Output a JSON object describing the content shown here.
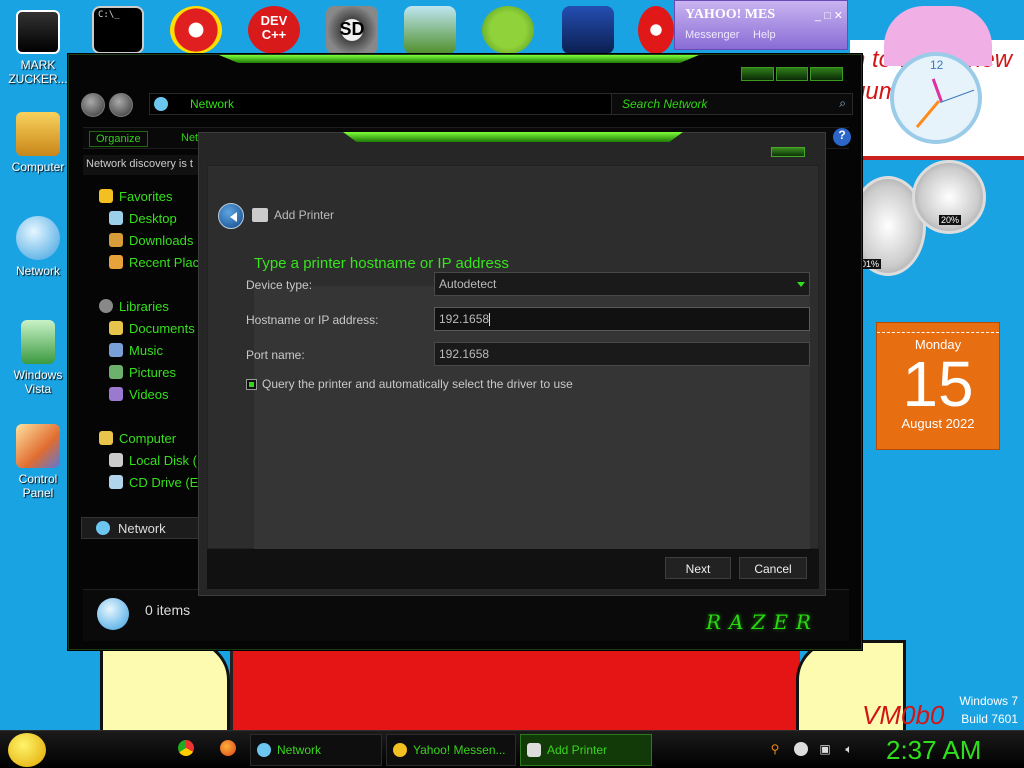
{
  "desktop": {
    "icons": [
      {
        "label": "MARK ZUCKER...",
        "icon": "person-icon"
      },
      {
        "label": "Computer",
        "icon": "computer-icon"
      },
      {
        "label": "Network",
        "icon": "network-icon"
      },
      {
        "label": "Windows Vista",
        "icon": "recycle-bin-icon"
      },
      {
        "label": "Control Panel",
        "icon": "control-panel-icon"
      }
    ],
    "top_icons": [
      "cmd-icon",
      "pinball-icon",
      "devcpp-icon",
      "settings-sd-icon",
      "folder-icon",
      "angry-birds-icon",
      "star-wars-icon",
      "radiation-icon"
    ],
    "devcpp_text": "DEV C++",
    "sd_text": "SD",
    "watermark_line1": "Windows 7",
    "watermark_line2": "Build 7601",
    "build_watermark": "VM0b0"
  },
  "explorer": {
    "address": "Network",
    "search_placeholder": "Search Network",
    "organize": "Organize",
    "toolbar_cut": "Net",
    "discovery_notice": "Network discovery is t",
    "nav": [
      {
        "label": "Favorites",
        "icon": "star-icon"
      },
      {
        "label": "Desktop",
        "icon": "desktop-icon"
      },
      {
        "label": "Downloads",
        "icon": "downloads-icon"
      },
      {
        "label": "Recent Plac",
        "icon": "recent-places-icon"
      },
      {
        "label": "Libraries",
        "icon": "libraries-icon"
      },
      {
        "label": "Documents",
        "icon": "documents-icon"
      },
      {
        "label": "Music",
        "icon": "music-icon"
      },
      {
        "label": "Pictures",
        "icon": "pictures-icon"
      },
      {
        "label": "Videos",
        "icon": "videos-icon"
      },
      {
        "label": "Computer",
        "icon": "computer-icon"
      },
      {
        "label": "Local Disk (",
        "icon": "disk-icon"
      },
      {
        "label": "CD Drive (E",
        "icon": "cd-drive-icon"
      }
    ],
    "nav_selected": "Network",
    "item_count": "0 items",
    "brand": "RAZER"
  },
  "dialog": {
    "title": "Add Printer",
    "heading": "Type a printer hostname or IP address",
    "device_type_label": "Device type:",
    "device_type_value": "Autodetect",
    "hostname_label": "Hostname or IP address:",
    "hostname_value": "192.1658",
    "port_label": "Port name:",
    "port_value": "192.1658",
    "query_label": "Query the printer and automatically select the driver to use",
    "query_checked": true,
    "next": "Next",
    "cancel": "Cancel"
  },
  "gadgets": {
    "clock_number": "12",
    "calendar_day": "Monday",
    "calendar_date": "15",
    "calendar_month": "August 2022",
    "cpu_percent": "01%",
    "ram_percent": "20%",
    "background_text": "n to whit a new gum"
  },
  "yahoo": {
    "logo": "YAHOO! MES",
    "messenger": "Messenger",
    "help": "Help"
  },
  "taskbar": {
    "quick_launch": [
      "chrome-icon",
      "firefox-icon"
    ],
    "buttons": [
      {
        "label": "Network",
        "icon": "network-icon",
        "active": false
      },
      {
        "label": "Yahoo! Messen...",
        "icon": "yahoo-icon",
        "active": false
      },
      {
        "label": "Add Printer",
        "icon": "printer-icon",
        "active": true
      }
    ],
    "time": "2:37 AM"
  },
  "colors": {
    "accent_green": "#38e41e",
    "desktop_blue": "#1aa3e3",
    "calendar_orange": "#e86e12"
  }
}
